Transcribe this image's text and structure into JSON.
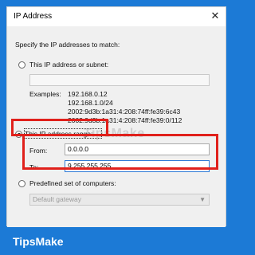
{
  "dialog": {
    "title": "IP Address",
    "close_glyph": "✕",
    "instruction": "Specify the IP addresses to match:",
    "options": {
      "subnet_label": "This IP address or subnet:",
      "range_label": "This IP address range:",
      "predefined_label": "Predefined set of computers:"
    },
    "subnet_value": "",
    "examples_label": "Examples:",
    "examples": [
      "192.168.0.12",
      "192.168.1.0/24",
      "2002:9d3b:1a31:4:208:74ff:fe39:6c43",
      "2002:9d3b:1a31:4:208:74ff:fe39:0/112"
    ],
    "from_label": "From:",
    "from_value": "0.0.0.0",
    "to_label": "To:",
    "to_value": "9.255.255.255",
    "predefined_selected": "Default gateway",
    "selected_option": "range"
  },
  "watermark": "TipsMake",
  "brand": "TipsMake",
  "colors": {
    "background": "#1c7ad6",
    "highlight": "#e0201b"
  },
  "icons": {
    "close": "close-icon",
    "dropdown": "chevron-down-icon"
  }
}
